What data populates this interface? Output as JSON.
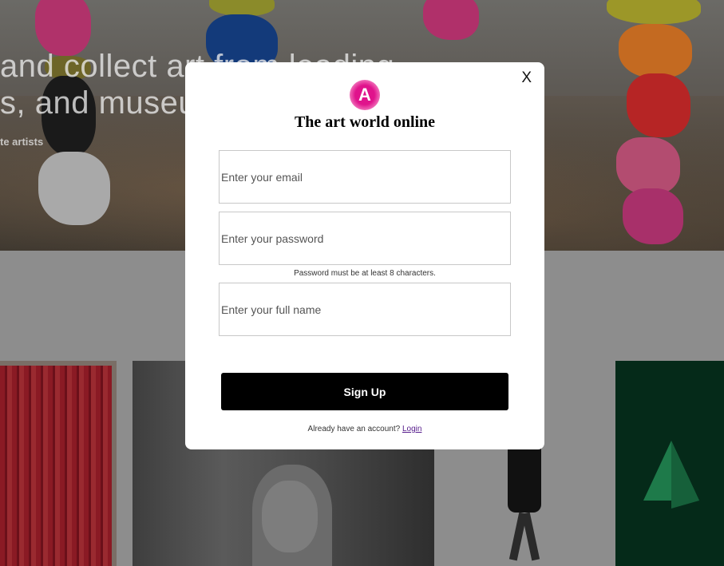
{
  "background": {
    "hero_line1": "and collect art from leading",
    "hero_line2": "s, and museu",
    "hero_sub": "te artists"
  },
  "modal": {
    "close_label": "X",
    "logo_letter": "A",
    "title": "The art world online",
    "email_placeholder": "Enter your email",
    "password_placeholder": "Enter your password",
    "password_hint": "Password must be at least 8 characters.",
    "fullname_placeholder": "Enter your full name",
    "signup_label": "Sign Up",
    "login_prompt": "Already have an account?",
    "login_link": "Login"
  },
  "colors": {
    "brand": "#e0138c",
    "button": "#000000",
    "link": "#551a8b"
  }
}
